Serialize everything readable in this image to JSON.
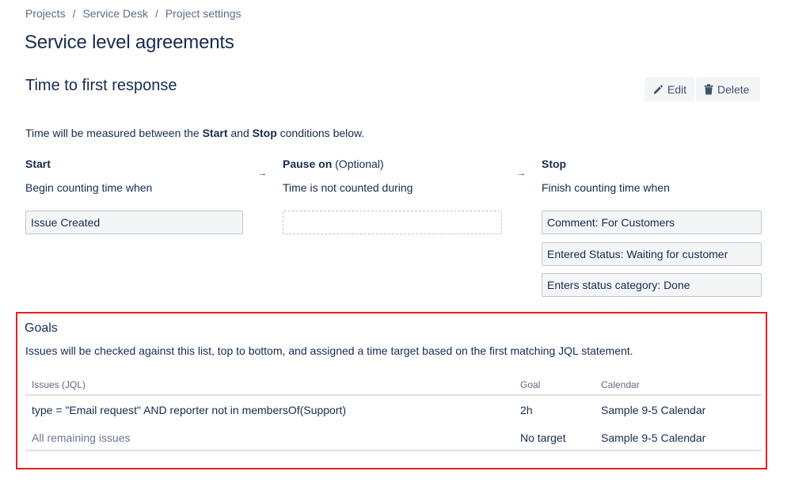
{
  "breadcrumb": [
    "Projects",
    "Service Desk",
    "Project settings"
  ],
  "breadcrumb_sep": "/",
  "page_title": "Service level agreements",
  "sla": {
    "name": "Time to first response",
    "edit_label": "Edit",
    "delete_label": "Delete",
    "measure_prefix": "Time will be measured between the ",
    "measure_start": "Start",
    "measure_and": " and ",
    "measure_stop": "Stop",
    "measure_suffix": " conditions below."
  },
  "columns": {
    "start": {
      "title": "Start",
      "subtitle": "Begin counting time when",
      "conditions": [
        "Issue Created"
      ]
    },
    "pause": {
      "title": "Pause on",
      "optional": "(Optional)",
      "subtitle": "Time is not counted during",
      "conditions": []
    },
    "stop": {
      "title": "Stop",
      "subtitle": "Finish counting time when",
      "conditions": [
        "Comment: For Customers",
        "Entered Status: Waiting for customer",
        "Enters status category: Done"
      ]
    }
  },
  "arrow_glyph": "→",
  "goals": {
    "title": "Goals",
    "description": "Issues will be checked against this list, top to bottom, and assigned a time target based on the first matching JQL statement.",
    "headers": {
      "jql": "Issues (JQL)",
      "goal": "Goal",
      "calendar": "Calendar"
    },
    "rows": [
      {
        "jql": "type = \"Email request\" AND reporter not in membersOf(Support)",
        "goal": "2h",
        "calendar": "Sample 9-5 Calendar"
      },
      {
        "jql": "All remaining issues",
        "goal": "No target",
        "calendar": "Sample 9-5 Calendar"
      }
    ]
  },
  "icons": {
    "edit": "pencil-icon",
    "delete": "trash-icon"
  },
  "colors": {
    "highlight_border": "#e5201f",
    "text": "#172b4d",
    "muted": "#5e6c84"
  }
}
